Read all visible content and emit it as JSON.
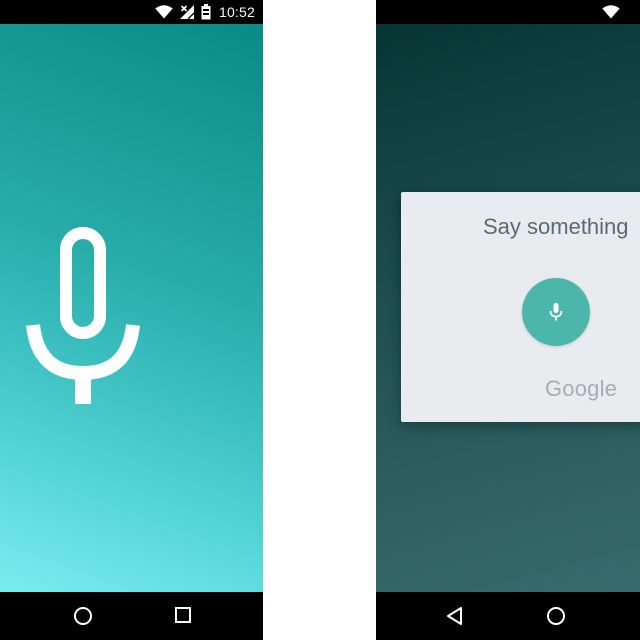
{
  "left_phone": {
    "status_bar": {
      "time": "10:52",
      "icons": [
        "wifi-icon",
        "cell-signal-no-service-icon",
        "battery-icon"
      ]
    },
    "screen": {
      "icon": "microphone-icon",
      "colors": {
        "gradient_top": "#0a8a86",
        "gradient_bottom": "#79edf0",
        "icon": "#ffffff"
      }
    },
    "nav_bar": {
      "buttons": [
        "home-icon",
        "recents-icon"
      ]
    }
  },
  "right_phone": {
    "screen": {
      "colors": {
        "gradient_top": "#063534",
        "gradient_bottom": "#376b6c"
      }
    },
    "voice_card": {
      "prompt": "Say something",
      "mic_icon": "microphone-icon",
      "brand": "Google",
      "colors": {
        "card_bg": "#e9ecee",
        "mic_button": "#4db6ac",
        "prompt_text": "#5a6a78",
        "brand_text": "#a9adb1"
      }
    },
    "nav_bar": {
      "buttons": [
        "back-icon",
        "home-icon"
      ]
    }
  }
}
